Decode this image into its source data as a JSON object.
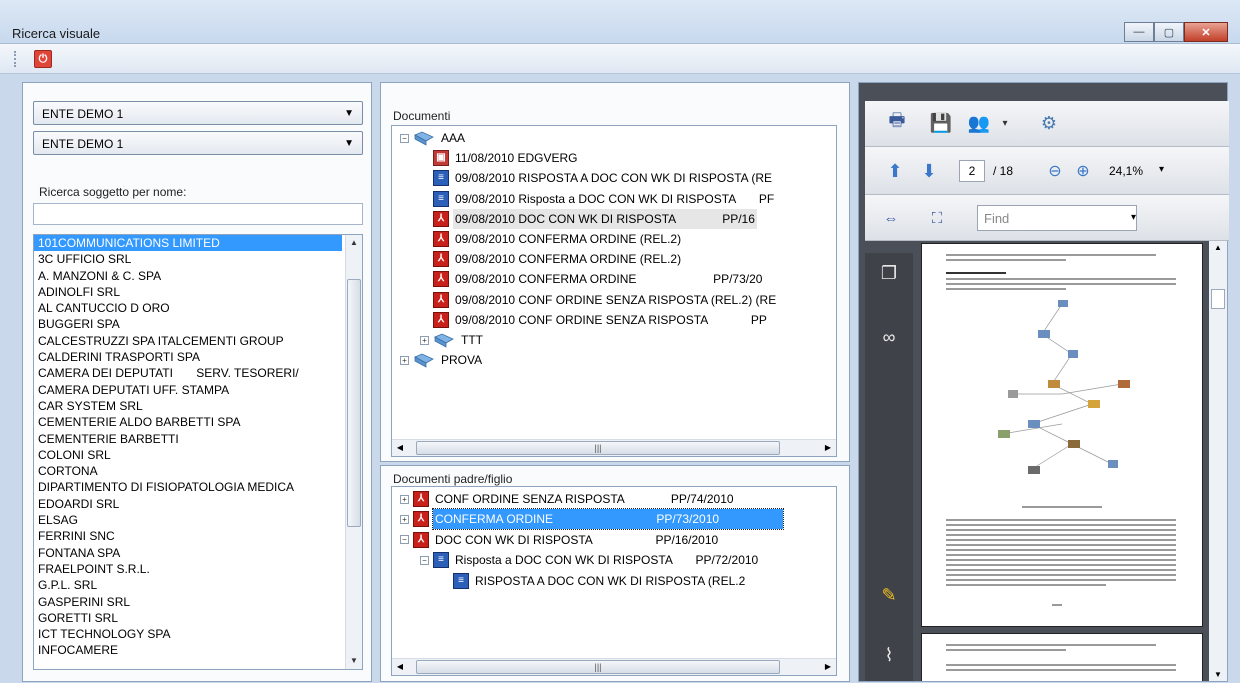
{
  "window": {
    "title": "Ricerca visuale",
    "minimize": "—",
    "maximize": "▢",
    "close": "✕"
  },
  "toolbar": {
    "power_glyph": "⏻"
  },
  "left": {
    "select1": "ENTE DEMO 1",
    "select2": "ENTE DEMO 1",
    "search_label": "Ricerca soggetto per nome:",
    "search_value": "",
    "subjects": [
      "101COMMUNICATIONS LIMITED",
      "3C UFFICIO SRL",
      "A. MANZONI & C. SPA",
      "ADINOLFI SRL",
      "AL CANTUCCIO D ORO",
      "BUGGERI SPA",
      "CALCESTRUZZI SPA ITALCEMENTI GROUP",
      "CALDERINI TRASPORTI SPA",
      "CAMERA DEI DEPUTATI       SERV. TESORERI/",
      "CAMERA DEPUTATI UFF. STAMPA",
      "CAR SYSTEM SRL",
      "CEMENTERIE ALDO BARBETTI SPA",
      "CEMENTERIE BARBETTI",
      "COLONI SRL",
      "CORTONA",
      "DIPARTIMENTO DI FISIOPATOLOGIA MEDICA",
      "EDOARDI SRL",
      "ELSAG",
      "FERRINI SNC",
      "FONTANA SPA",
      "FRAELPOINT S.R.L.",
      "G.P.L. SRL",
      "GASPERINI SRL",
      "GORETTI SRL",
      "ICT TECHNOLOGY SPA",
      "INFOCAMERE"
    ]
  },
  "documents": {
    "title": "Documenti",
    "tree": [
      {
        "level": 0,
        "exp": "−",
        "icon": "folder",
        "text": "AAA"
      },
      {
        "level": 1,
        "exp": "",
        "icon": "img",
        "text": "11/08/2010 EDGVERG"
      },
      {
        "level": 1,
        "exp": "",
        "icon": "doc",
        "text": "09/08/2010 RISPOSTA A DOC CON WK DI RISPOSTA (RE"
      },
      {
        "level": 1,
        "exp": "",
        "icon": "doc",
        "text": "09/08/2010 Risposta a DOC CON WK DI RISPOSTA       PF"
      },
      {
        "level": 1,
        "exp": "",
        "icon": "pdf",
        "text": "09/08/2010 DOC CON WK DI RISPOSTA              PP/16",
        "highlight": true
      },
      {
        "level": 1,
        "exp": "",
        "icon": "pdf",
        "text": "09/08/2010 CONFERMA ORDINE (REL.2)"
      },
      {
        "level": 1,
        "exp": "",
        "icon": "pdf",
        "text": "09/08/2010 CONFERMA ORDINE (REL.2)"
      },
      {
        "level": 1,
        "exp": "",
        "icon": "pdf",
        "text": "09/08/2010 CONFERMA ORDINE                       PP/73/20"
      },
      {
        "level": 1,
        "exp": "",
        "icon": "pdf",
        "text": "09/08/2010 CONF ORDINE SENZA RISPOSTA (REL.2) (RE"
      },
      {
        "level": 1,
        "exp": "",
        "icon": "pdf",
        "text": "09/08/2010 CONF ORDINE SENZA RISPOSTA             PP"
      },
      {
        "level": 1,
        "exp": "+",
        "icon": "folder",
        "text": "TTT"
      },
      {
        "level": 0,
        "exp": "+",
        "icon": "folder",
        "text": "PROVA"
      }
    ]
  },
  "parent_child": {
    "title": "Documenti padre/figlio",
    "tree": [
      {
        "level": 0,
        "exp": "+",
        "icon": "pdf",
        "text": "CONF ORDINE SENZA RISPOSTA              PP/74/2010"
      },
      {
        "level": 0,
        "exp": "+",
        "icon": "pdf",
        "text": "CONFERMA ORDINE                               PP/73/2010",
        "selected": true
      },
      {
        "level": 0,
        "exp": "−",
        "icon": "pdf",
        "text": "DOC CON WK DI RISPOSTA                   PP/16/2010"
      },
      {
        "level": 1,
        "exp": "−",
        "icon": "doc",
        "text": "Risposta a DOC CON WK DI RISPOSTA       PP/72/2010"
      },
      {
        "level": 2,
        "exp": "",
        "icon": "doc",
        "text": "RISPOSTA A DOC CON WK DI RISPOSTA (REL.2"
      }
    ]
  },
  "viewer": {
    "page_current": "2",
    "page_total": "/ 18",
    "zoom": "24,1%",
    "find_placeholder": "Find"
  }
}
